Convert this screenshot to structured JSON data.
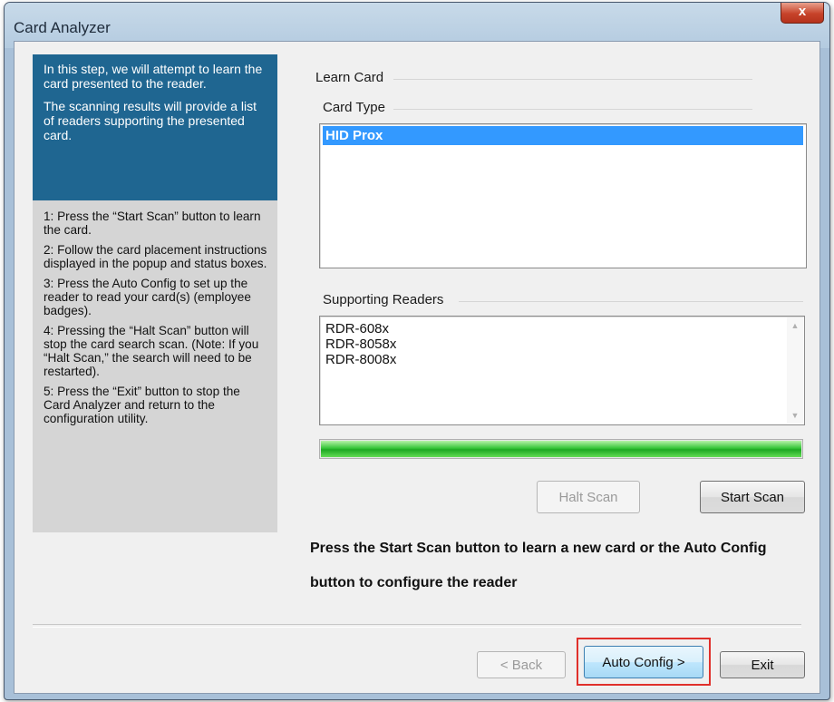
{
  "window": {
    "title": "Card Analyzer",
    "close_glyph": "x"
  },
  "left_panel": {
    "intro": [
      "In this step, we will attempt to learn the card presented to the reader.",
      "The scanning results will provide a list of readers supporting the presented card."
    ],
    "steps": [
      "1: Press the “Start Scan” button to learn the card.",
      "2: Follow the card placement instructions displayed in the popup and status boxes.",
      "3: Press the Auto Config to set up the reader to read your card(s) (employee badges).",
      "4: Pressing the “Halt Scan” button will stop the card search scan. (Note: If you “Halt Scan,” the search will need to be restarted).",
      "5: Press the “Exit” button to stop the Card Analyzer and return to the configuration utility."
    ]
  },
  "learn_card": {
    "group_label": "Learn Card",
    "card_type_label": "Card Type",
    "card_types": [
      "HID Prox"
    ],
    "selected_card_type": "HID Prox",
    "supporting_readers_label": "Supporting Readers",
    "readers": [
      "RDR-608x",
      "RDR-8058x",
      "RDR-8008x"
    ],
    "progress": 1.0,
    "halt_scan_label": "Halt Scan",
    "start_scan_label": "Start Scan",
    "status_text": "Press the Start Scan button to learn a new card or the Auto Config button to configure the reader"
  },
  "footer": {
    "back_label": "< Back",
    "auto_config_label": "Auto Config >",
    "exit_label": "Exit"
  },
  "colors": {
    "intro_background": "#1f6691",
    "selection": "#3399ff",
    "progress_fill": "#37c63a",
    "highlight_box": "#e0302b"
  }
}
